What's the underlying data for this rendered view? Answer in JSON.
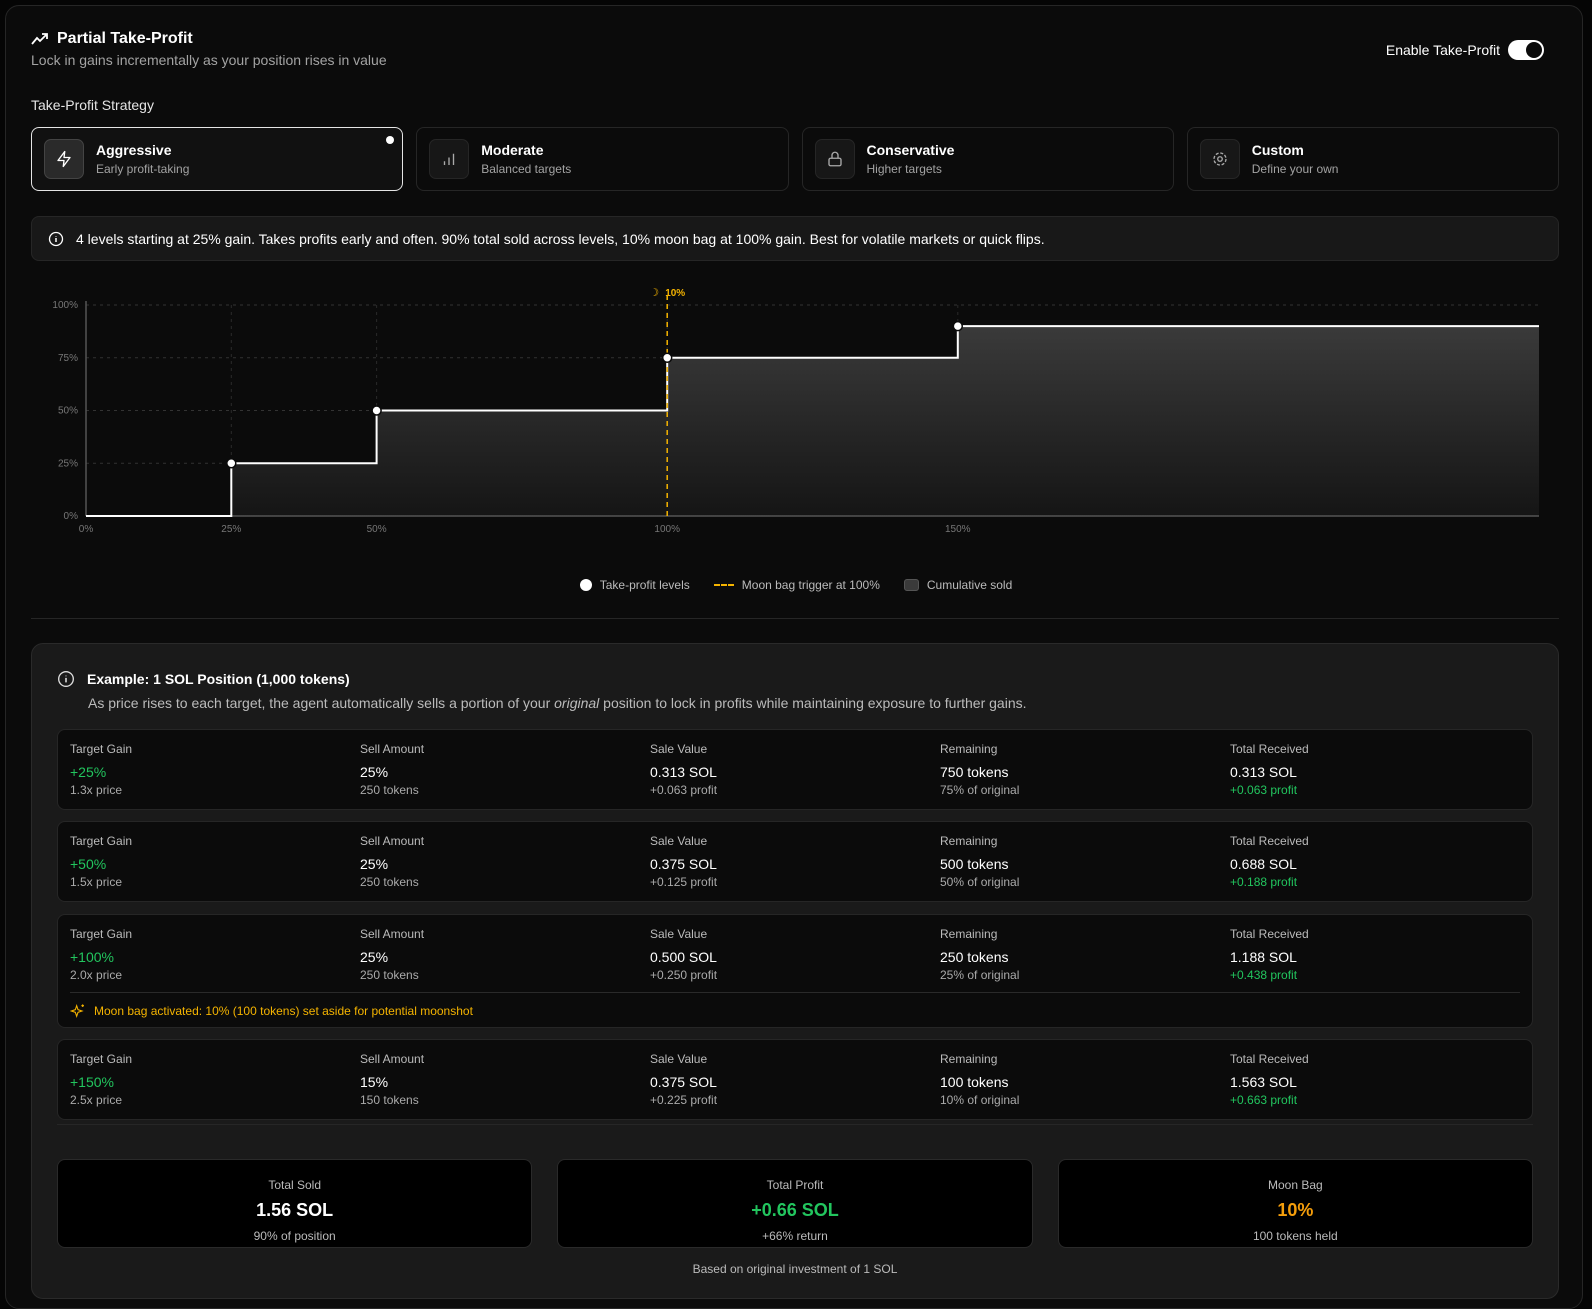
{
  "header": {
    "title": "Partial Take-Profit",
    "subtitle": "Lock in gains incrementally as your position rises in value",
    "toggle_label": "Enable Take-Profit",
    "toggle_on": true
  },
  "strategy": {
    "label": "Take-Profit Strategy",
    "selected": "Aggressive",
    "options": [
      {
        "name": "Aggressive",
        "desc": "Early profit-taking",
        "icon": "lightning-icon"
      },
      {
        "name": "Moderate",
        "desc": "Balanced targets",
        "icon": "bar-chart-icon"
      },
      {
        "name": "Conservative",
        "desc": "Higher targets",
        "icon": "lock-icon"
      },
      {
        "name": "Custom",
        "desc": "Define your own",
        "icon": "gear-icon"
      }
    ]
  },
  "info": "4 levels starting at 25% gain. Takes profits early and often. 90% total sold across levels, 10% moon bag at 100% gain. Best for volatile markets or quick flips.",
  "chart_data": {
    "type": "line",
    "step": true,
    "x": [
      0,
      25,
      50,
      100,
      150,
      250
    ],
    "y": [
      0,
      25,
      50,
      75,
      90,
      90
    ],
    "points": [
      [
        25,
        25
      ],
      [
        50,
        50
      ],
      [
        100,
        75
      ],
      [
        150,
        90
      ]
    ],
    "xlim": [
      0,
      250
    ],
    "ylim": [
      0,
      100
    ],
    "xticks": [
      "0%",
      "25%",
      "50%",
      "100%",
      "150%"
    ],
    "xtick_values": [
      0,
      25,
      50,
      100,
      150
    ],
    "yticks": [
      "0%",
      "25%",
      "50%",
      "75%",
      "100%"
    ],
    "ytick_values": [
      0,
      25,
      50,
      75,
      100
    ],
    "moon_trigger_x": 100,
    "moon_label": "10%",
    "grid": true,
    "legend": [
      "Take-profit levels",
      "Moon bag trigger at 100%",
      "Cumulative sold"
    ],
    "legend_placement": "bottom-center",
    "colors": {
      "line": "#ffffff",
      "moon": "#f5b400"
    }
  },
  "example": {
    "title": "Example: 1 SOL Position (1,000 tokens)",
    "desc_pre": "As price rises to each target, the agent automatically sells a portion of your ",
    "desc_em": "original",
    "desc_post": " position to lock in profits while maintaining exposure to further gains.",
    "headers": [
      "Target Gain",
      "Sell Amount",
      "Sale Value",
      "Remaining",
      "Total Received"
    ],
    "rows": [
      {
        "gain": "+25%",
        "price": "1.3x price",
        "sell": "25%",
        "sell_tokens": "250 tokens",
        "sale": "0.313 SOL",
        "sale_profit": "+0.063 profit",
        "remaining": "750 tokens",
        "remaining_pct": "75% of original",
        "total": "0.313 SOL",
        "total_profit": "+0.063 profit"
      },
      {
        "gain": "+50%",
        "price": "1.5x price",
        "sell": "25%",
        "sell_tokens": "250 tokens",
        "sale": "0.375 SOL",
        "sale_profit": "+0.125 profit",
        "remaining": "500 tokens",
        "remaining_pct": "50% of original",
        "total": "0.688 SOL",
        "total_profit": "+0.188 profit"
      },
      {
        "gain": "+100%",
        "price": "2.0x price",
        "sell": "25%",
        "sell_tokens": "250 tokens",
        "sale": "0.500 SOL",
        "sale_profit": "+0.250 profit",
        "remaining": "250 tokens",
        "remaining_pct": "25% of original",
        "total": "1.188 SOL",
        "total_profit": "+0.438 profit",
        "moon": "Moon bag activated: 10% (100 tokens) set aside for potential moonshot"
      },
      {
        "gain": "+150%",
        "price": "2.5x price",
        "sell": "15%",
        "sell_tokens": "150 tokens",
        "sale": "0.375 SOL",
        "sale_profit": "+0.225 profit",
        "remaining": "100 tokens",
        "remaining_pct": "10% of original",
        "total": "1.563 SOL",
        "total_profit": "+0.663 profit"
      }
    ],
    "summary": [
      {
        "label": "Total Sold",
        "value": "1.56 SOL",
        "sub": "90% of position",
        "color": "#ffffff"
      },
      {
        "label": "Total Profit",
        "value": "+0.66 SOL",
        "sub": "+66% return",
        "color": "#22c55e"
      },
      {
        "label": "Moon Bag",
        "value": "10%",
        "sub": "100 tokens held",
        "color": "#f59e0b"
      }
    ],
    "footnote": "Based on original investment of 1 SOL"
  }
}
